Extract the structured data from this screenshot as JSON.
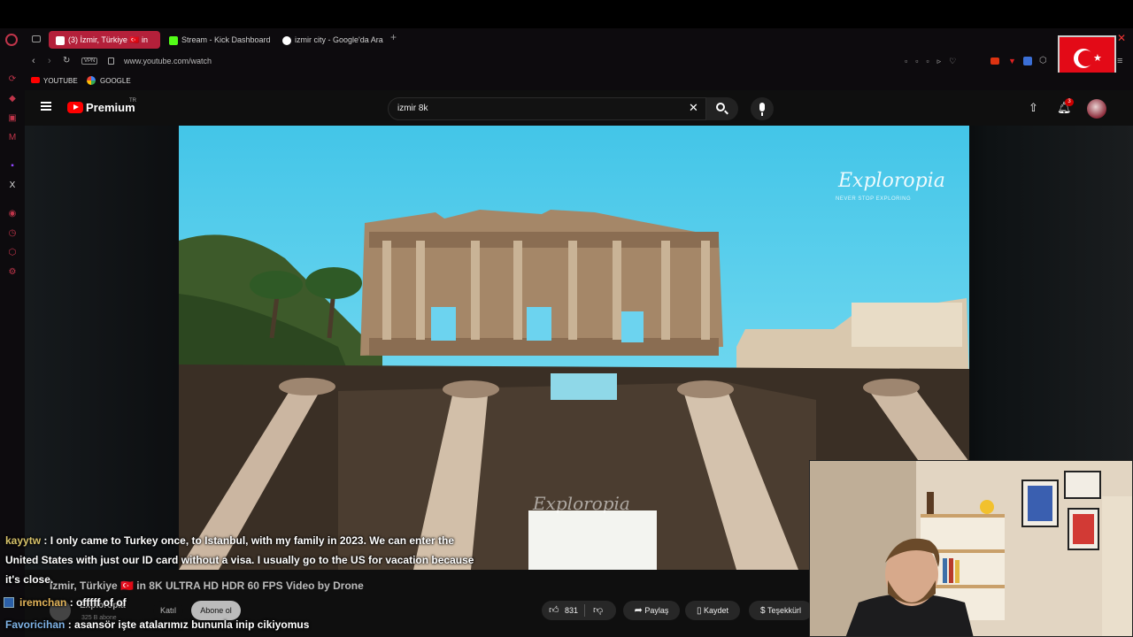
{
  "tabs": [
    {
      "label": "(3) İzmir, Türkiye 🇹🇷 in",
      "active": true,
      "icon": "youtube-icon"
    },
    {
      "label": "Stream - Kick Dashboard",
      "active": false,
      "icon": "kick-icon"
    },
    {
      "label": "izmir city - Google'da Ara",
      "active": false,
      "icon": "google-icon"
    }
  ],
  "address": {
    "vpn": "VPN",
    "url": "www.youtube.com/watch"
  },
  "bookmarks": [
    {
      "label": "YOUTUBE",
      "icon": "youtube-icon"
    },
    {
      "label": "GOOGLE",
      "icon": "google-icon"
    }
  ],
  "youtube": {
    "logo": "Premium",
    "logo_region": "TR",
    "search_value": "izmir 8k",
    "notification_count": "3"
  },
  "video": {
    "watermark_title": "Exploropia",
    "watermark_subtitle": "NEVER STOP EXPLORING",
    "bottom_watermark": "Exploropia"
  },
  "below": {
    "title": "İzmir, Türkiye 🇹🇷 in 8K ULTRA HD HDR 60 FPS Video by Drone",
    "channel": "Exploropia",
    "subscribers": "325 B abone",
    "join_label": "Katıl",
    "subscribe_label": "Abone ol",
    "likes": "831",
    "share_label": "Paylaş",
    "save_label": "Kaydet",
    "thanks_label": "Teşekkürl"
  },
  "chat": [
    {
      "user": "kayytw",
      "text": " : I only came to Turkey once, to Istanbul, with my family in 2023. We can enter the United States with just our ID card without a visa. I usually go to the US for vacation because it's close."
    },
    {
      "user": "iremchan",
      "text": " : offfff of of"
    },
    {
      "user": "Favoricihan",
      "text": " : asansör işte atalarımız bununla inip cikiyomus"
    }
  ],
  "colors": {
    "accent": "#b4203a",
    "youtube_red": "#ff0000"
  }
}
